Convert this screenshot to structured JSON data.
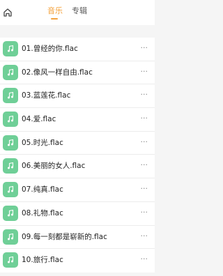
{
  "header": {
    "home_icon": "home-icon",
    "tabs": [
      {
        "label": "音乐",
        "active": true
      },
      {
        "label": "专辑",
        "active": false
      }
    ],
    "accent_color": "#f4a23c"
  },
  "list": {
    "thumb_icon": "music-note-icon",
    "thumb_color": "#6fcf97",
    "more_label": "···",
    "items": [
      {
        "title": "01.曾经的你.flac"
      },
      {
        "title": "02.像风一样自由.flac"
      },
      {
        "title": "03.蓝莲花.flac"
      },
      {
        "title": "04.爱.flac"
      },
      {
        "title": "05.时光.flac"
      },
      {
        "title": "06.美丽的女人.flac"
      },
      {
        "title": "07.纯真.flac"
      },
      {
        "title": "08.礼物.flac"
      },
      {
        "title": "09.每一刻都是崭新的.flac"
      },
      {
        "title": "10.旅行.flac"
      }
    ]
  }
}
